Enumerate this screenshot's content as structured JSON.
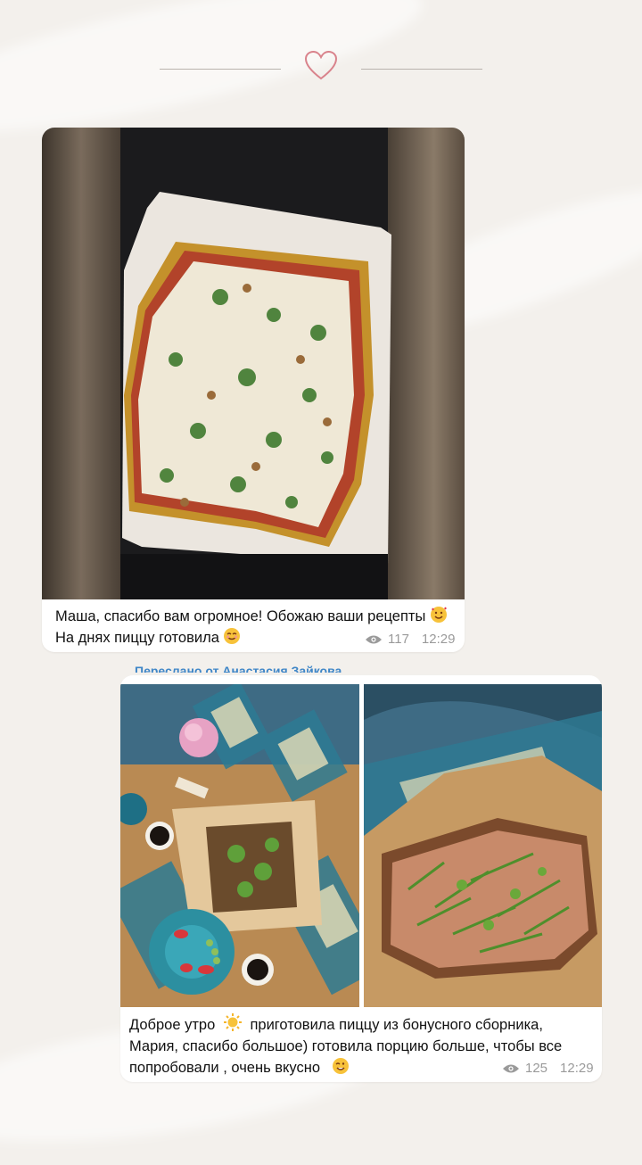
{
  "messages": [
    {
      "lines": [
        "Маша, спасибо вам огромное! Обожаю ваши рецепты",
        "На днях пиццу готовила"
      ],
      "emoji_line1": "smiling-face-with-hearts",
      "emoji_line2": "smiling-face-with-smiling-eyes",
      "views": "117",
      "time": "12:29"
    },
    {
      "forwarded_from": "Переслано от Анастасия Зайкова",
      "lines": [
        "Доброе утро",
        "приготовила пиццу из бонусного сборника,",
        "Мария, спасибо большое) готовила порцию больше, чтобы все",
        "попробовали , очень вкусно"
      ],
      "emoji_sun": "sun-icon",
      "emoji_end": "smiling-face",
      "views": "125",
      "time": "12:29"
    }
  ],
  "colors": {
    "background": "#f3f0ec",
    "heart": "#d9838c",
    "meta": "#9a9a9a",
    "link": "#3f86c7"
  }
}
